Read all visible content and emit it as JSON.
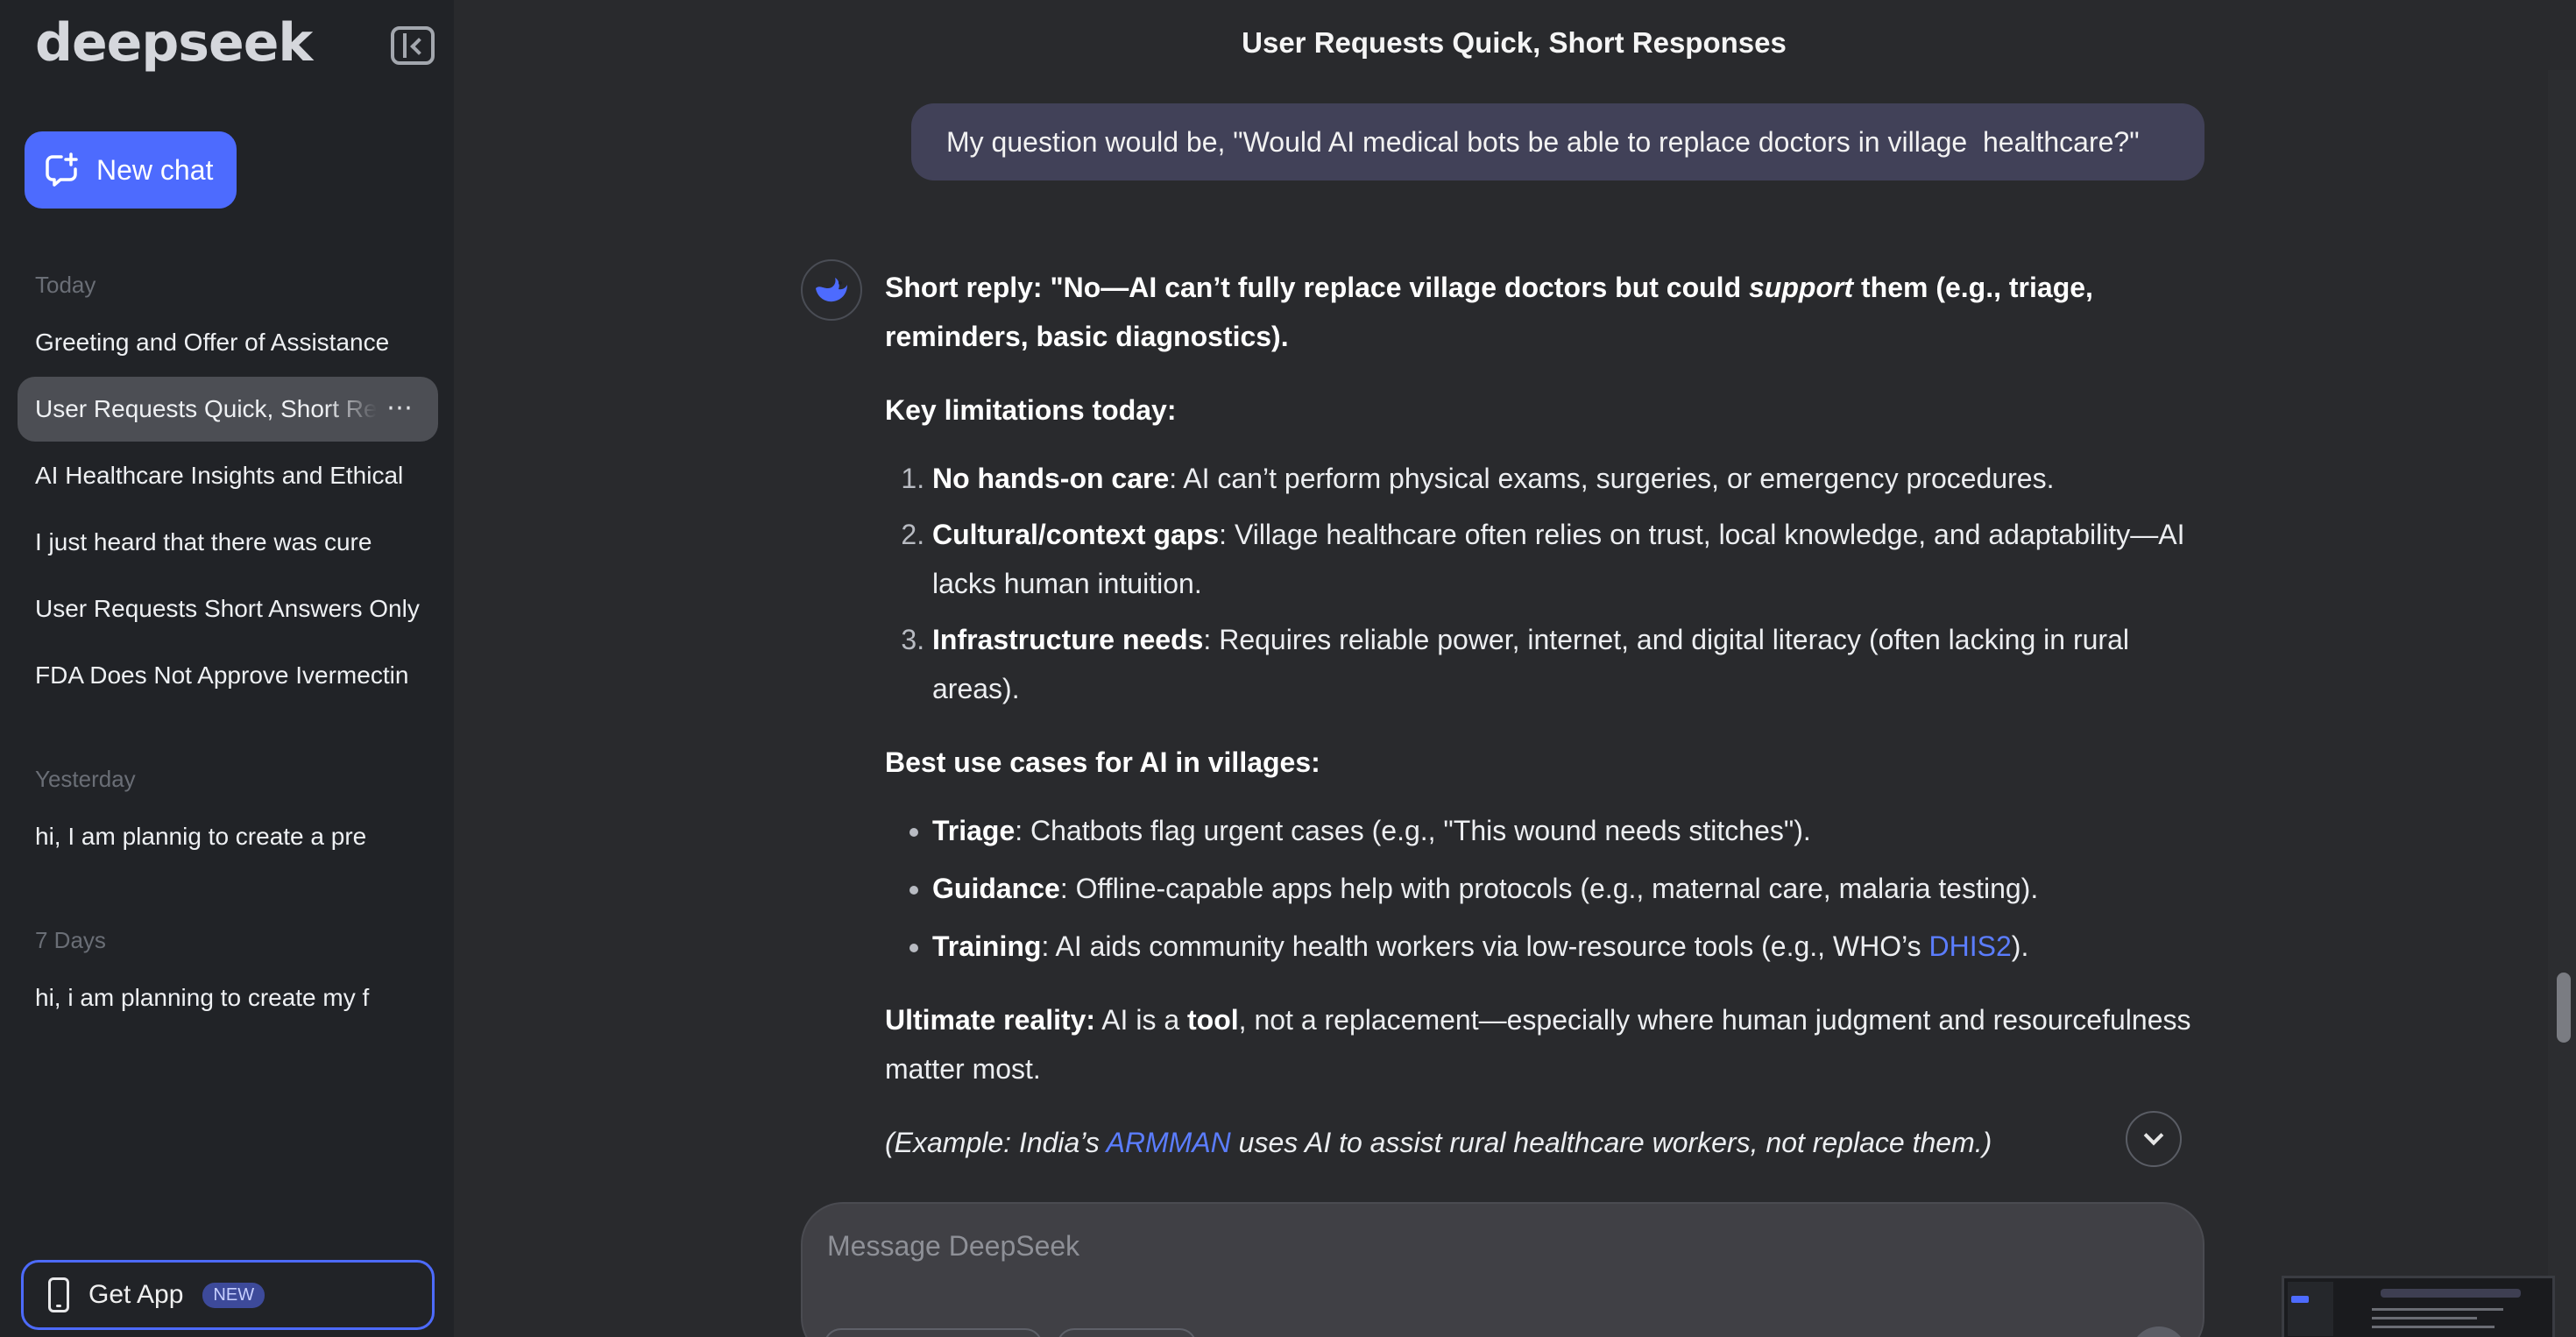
{
  "sidebar": {
    "logo": "deepseek",
    "new_chat_label": "New chat",
    "sections": [
      {
        "label": "Today",
        "items": [
          "Greeting and Offer of Assistance",
          "User Requests Quick, Short Responses",
          "AI Healthcare Insights and Ethical",
          "I just heard that there was cure",
          "User Requests Short Answers Only",
          "FDA Does Not Approve Ivermectin"
        ]
      },
      {
        "label": "Yesterday",
        "items": [
          "hi, I am plannig to create a pre"
        ]
      },
      {
        "label": "7 Days",
        "items": [
          "hi, i am planning to create my f"
        ]
      }
    ],
    "more_icon": "⋯",
    "get_app_label": "Get App",
    "new_badge": "NEW"
  },
  "header": {
    "title": "User Requests Quick, Short Responses"
  },
  "user_message": "My question would be, \"Would AI medical bots be able to replace doctors in village  healthcare?\"",
  "answer": {
    "short_reply_a": "Short reply: \"No—AI can’t fully replace village doctors but could ",
    "short_reply_em": "support",
    "short_reply_b": " them (e.g., triage, reminders, basic diagnostics).",
    "limitations_heading": "Key limitations today:",
    "limitations": [
      {
        "bold": "No hands-on care",
        "text": ": AI can’t perform physical exams, surgeries, or emergency procedures."
      },
      {
        "bold": "Cultural/context gaps",
        "text": ": Village healthcare often relies on trust, local knowledge, and adaptability—AI lacks human intuition."
      },
      {
        "bold": "Infrastructure needs",
        "text": ": Requires reliable power, internet, and digital literacy (often lacking in rural areas)."
      }
    ],
    "usecases_heading": "Best use cases for AI in villages:",
    "usecases": [
      {
        "bold": "Triage",
        "text": ": Chatbots flag urgent cases (e.g., \"This wound needs stitches\")."
      },
      {
        "bold": "Guidance",
        "text": ": Offline-capable apps help with protocols (e.g., maternal care, malaria testing)."
      },
      {
        "bold": "Training",
        "text": ": AI aids community health workers via low-resource tools (e.g., WHO’s ",
        "link": "DHIS2",
        "after": ")."
      }
    ],
    "ultimate_bold": "Ultimate reality:",
    "ultimate_a": " AI is a ",
    "ultimate_tool": "tool",
    "ultimate_b": ", not a replacement—especially where human judgment and resourcefulness matter most.",
    "example_a": "(Example: India’s ",
    "example_link": "ARMMAN",
    "example_b": " uses AI to assist rural healthcare workers, not replace them.)"
  },
  "composer": {
    "placeholder": "Message DeepSeek"
  },
  "colors": {
    "accent": "#4d6bfe",
    "link": "#5b7dff",
    "bubble": "#414158",
    "sidebar_bg": "#212327",
    "main_bg": "#292a2d"
  }
}
